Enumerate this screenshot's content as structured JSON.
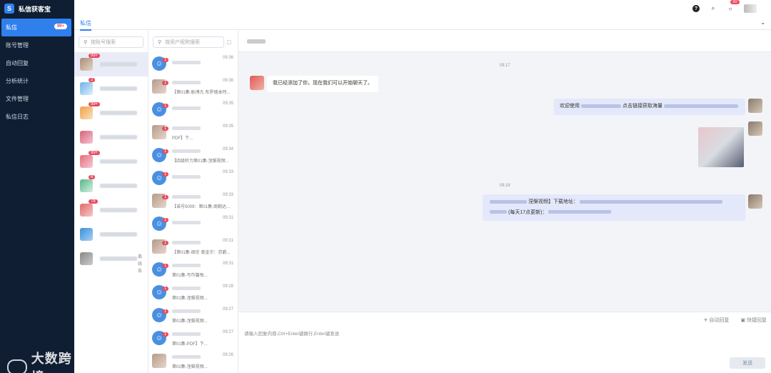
{
  "app": {
    "brand": "私信获客宝"
  },
  "nav": {
    "items": [
      {
        "label": "私信",
        "badge": "99+"
      },
      {
        "label": "账号管理"
      },
      {
        "label": "自动回复"
      },
      {
        "label": "分析统计"
      },
      {
        "label": "文件管理"
      },
      {
        "label": "私信日志"
      }
    ]
  },
  "topbar": {
    "help": "?",
    "search": "⌕",
    "bell": "🔔",
    "notif_count": "30"
  },
  "tabs": {
    "active": "私信",
    "chevron": "⌄"
  },
  "accounts": {
    "search_placeholder": "按账号搜索",
    "items": [
      {
        "badge": "99+"
      },
      {
        "badge": "2"
      },
      {
        "badge": "99+"
      },
      {
        "badge": ""
      },
      {
        "badge": "99+"
      },
      {
        "badge": "6"
      },
      {
        "badge": "78"
      },
      {
        "badge": ""
      },
      {
        "badge": "",
        "more": "离线条"
      }
    ]
  },
  "conversations": {
    "search_placeholder": "按用户昵称搜索",
    "items": [
      {
        "time": "09:36",
        "badge": "1",
        "preview": "",
        "photo": false
      },
      {
        "time": "09:36",
        "badge": "1",
        "preview": "【第01集-耿博凡 布罗德本特...",
        "photo": true
      },
      {
        "time": "09:35",
        "badge": "1",
        "preview": "",
        "photo": false
      },
      {
        "time": "09:35",
        "badge": "1",
        "preview": "PDF】下...",
        "photo": true
      },
      {
        "time": "09:34",
        "badge": "1",
        "preview": "【四级听力第01集-涅槃视频...",
        "photo": false
      },
      {
        "time": "09:33",
        "badge": "1",
        "preview": "",
        "photo": false
      },
      {
        "time": "09:33",
        "badge": "1",
        "preview": "【诺号5009：第01集-周朝达...",
        "photo": true
      },
      {
        "time": "09:31",
        "badge": "1",
        "preview": "",
        "photo": false
      },
      {
        "time": "09:31",
        "badge": "1",
        "preview": "【第01集-周伦 袁金尔：劳爵...",
        "photo": true
      },
      {
        "time": "09:31",
        "badge": "1",
        "preview": "第01集-写作篇每...",
        "photo": false
      },
      {
        "time": "09:28",
        "badge": "1",
        "preview": "第01集-涅槃视频...",
        "photo": false
      },
      {
        "time": "09:27",
        "badge": "1",
        "preview": "第01集-涅槃视频...",
        "photo": false
      },
      {
        "time": "09:27",
        "badge": "1",
        "preview": "第01集-PDF】下...",
        "photo": false
      },
      {
        "time": "09:26",
        "badge": "",
        "preview": "第02集-涅槃视频...",
        "photo": true
      }
    ]
  },
  "chat": {
    "sep1": "09:17",
    "msg1": "我已经添加了你，现在我们可以开始聊天了。",
    "msg2_prefix": "欢迎使用",
    "msg2_mid": "点击链接获取海量",
    "sep2": "09:18",
    "msg3_line1": "涅槃视频】下载地址：",
    "msg3_line2": "(每天17点更新)："
  },
  "compose": {
    "auto_reply": "✈ 自动回复",
    "quick_reply": "▣ 快捷回复",
    "placeholder": "请输入回复内容,Ctrl+Enter键换行,Enter键发送",
    "send": "发送"
  },
  "watermark": {
    "text": "大数跨境"
  }
}
